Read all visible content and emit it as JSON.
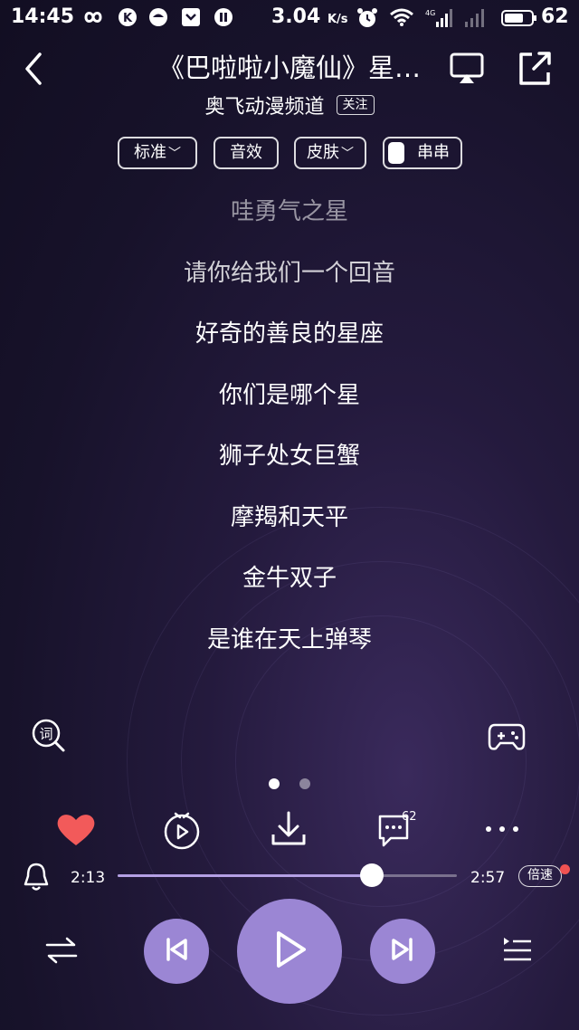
{
  "status_bar": {
    "time": "14:45",
    "network_speed": "3.04",
    "network_speed_unit": "K/s",
    "battery_level": "62",
    "icons": [
      "infinity-icon",
      "k-app-icon",
      "face-app-icon",
      "pocket-icon",
      "pause-app-icon",
      "alarm-icon",
      "wifi-icon",
      "signal-4g-icon",
      "signal-icon",
      "battery-icon"
    ]
  },
  "header": {
    "title": "《巴啦啦小魔仙》星…",
    "channel_name": "奥飞动漫频道",
    "follow_label": "关注"
  },
  "options": {
    "quality_label": "标准",
    "effects_label": "音效",
    "skin_label": "皮肤",
    "chuanchuan_label": "串串"
  },
  "lyrics": [
    "哇勇气之星",
    "请你给我们一个回音",
    "好奇的善良的星座",
    "你们是哪个星",
    "狮子处女巨蟹",
    "摩羯和天平",
    "金牛双子",
    "是谁在天上弹琴"
  ],
  "side_tools": {
    "lyrics_search_label": "词"
  },
  "pager": {
    "total": 2,
    "active": 1
  },
  "actions": {
    "comment_count": "62"
  },
  "progress": {
    "current_time": "2:13",
    "total_time": "2:57",
    "fraction": 0.75,
    "speed_label": "倍速"
  },
  "colors": {
    "accent": "#9b86d4",
    "heart": "#f25a5a",
    "background": "#17122a"
  }
}
